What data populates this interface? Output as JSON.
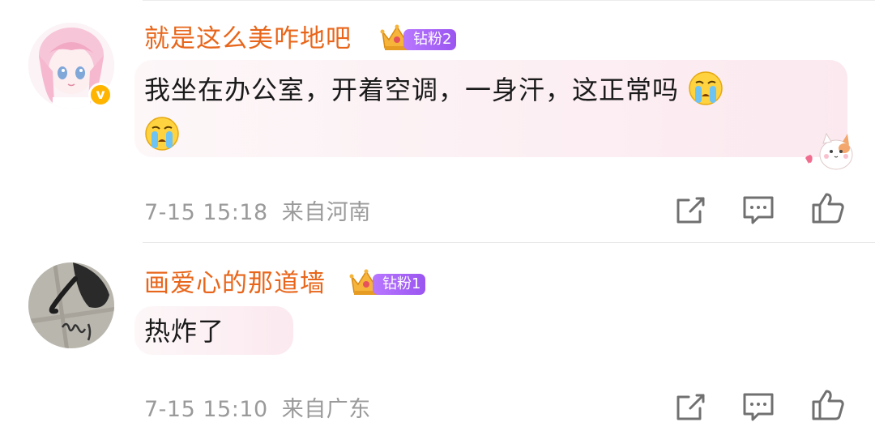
{
  "comments": [
    {
      "username": "就是这么美咋地吧",
      "badge": "钻粉2",
      "text": "我坐在办公室，开着空调，一身汗，这正常吗",
      "emoji": "crying-emoji",
      "time": "7-15 15:18",
      "location": "来自河南",
      "verified": true
    },
    {
      "username": "画爱心的那道墙",
      "badge": "钻粉1",
      "text": "热炸了",
      "time": "7-15 15:10",
      "location": "来自广东",
      "verified": false
    }
  ],
  "icons": [
    "share-icon",
    "comment-icon",
    "like-icon"
  ],
  "colors": {
    "username": "#e8661b",
    "badge": "#a866f5",
    "meta": "#9a9a9a",
    "bubble": "#fbe9ef",
    "verified": "#ffb400"
  }
}
